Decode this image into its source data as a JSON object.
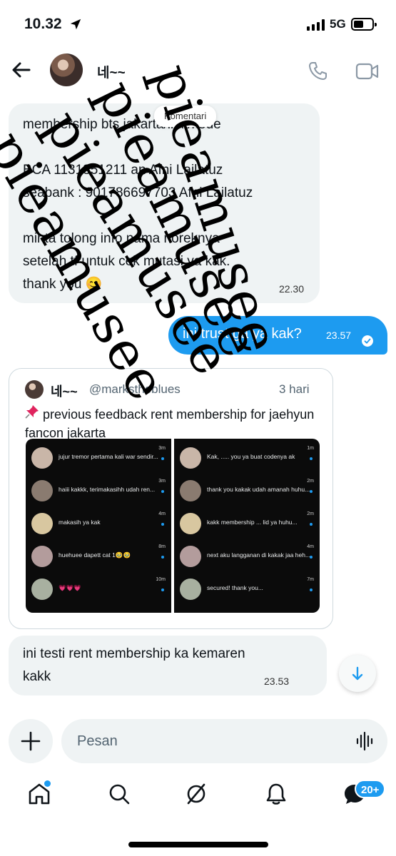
{
  "status_bar": {
    "time": "10.32",
    "network": "5G"
  },
  "header": {
    "contact_name": "네~~"
  },
  "messages": {
    "incoming_1": {
      "text": "membership bts jakarta/link/kode\n\nBCA 1131351211 an Afni Lailatuz\nseabank : 901786697703 Afni Lailatuz\n\nminta tolong info nama noreknya\nsetelah tf untuk cek mutasi ya kak.\nthank you 😊",
      "time": "22.30",
      "tooltip": "Komentari"
    },
    "outgoing_1": {
      "text": "ini trust ga ya kak?",
      "time": "23.57"
    },
    "quoted_post": {
      "name": "네~~",
      "handle": "@markstheblues",
      "age": "3 hari",
      "text": "previous feedback rent membership for jaehyun fancon jakarta",
      "left_rows": [
        {
          "text": "jujur tremor pertama kali war sendir...",
          "time": "3m"
        },
        {
          "text": "haiii kakkk, terimakasihh udah ren...",
          "time": "3m"
        },
        {
          "text": "makasih ya kak",
          "time": "4m"
        },
        {
          "text": "huehuee dapett cat 1🥹🥹",
          "time": "8m"
        },
        {
          "text": "💗💗💗",
          "time": "10m"
        }
      ],
      "right_rows": [
        {
          "text": "Kak, ..... you ya buat codenya ak",
          "time": "1m"
        },
        {
          "text": "thank you kakak udah amanah huhu...",
          "time": "2m"
        },
        {
          "text": "kakk membership ... lid ya huhu...",
          "time": "2m"
        },
        {
          "text": "next aku langganan di kakak jaa heh...",
          "time": "4m"
        },
        {
          "text": "secured! thank you...",
          "time": "7m"
        }
      ]
    },
    "incoming_2": {
      "text": "ini testi rent membership ka kemaren\nkakk",
      "time": "23.53"
    }
  },
  "composer": {
    "placeholder": "Pesan"
  },
  "tabbar": {
    "messages_badge": "20+"
  },
  "watermark": {
    "text": "pieamusee"
  },
  "colors": {
    "accent": "#1d9bf0",
    "bubble_in": "#eff3f4"
  }
}
